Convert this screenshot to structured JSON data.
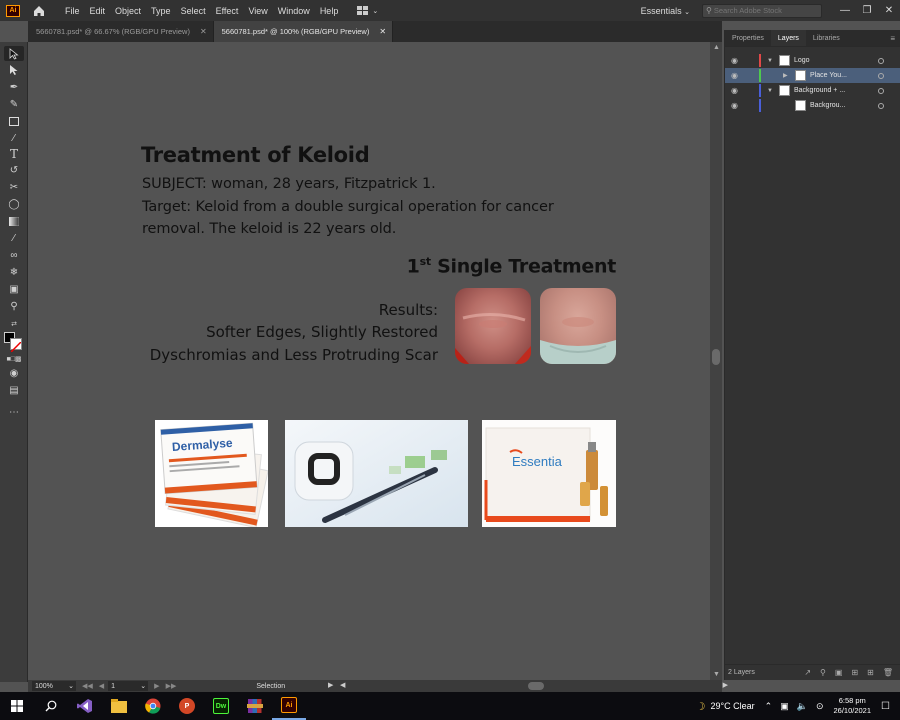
{
  "app": {
    "logo": "Ai",
    "menu": [
      "File",
      "Edit",
      "Object",
      "Type",
      "Select",
      "Effect",
      "View",
      "Window",
      "Help"
    ],
    "workspace": "Essentials",
    "search_placeholder": "Search Adobe Stock"
  },
  "tabs": [
    {
      "label": "5660781.psd* @ 66.67% (RGB/GPU Preview)",
      "active": false
    },
    {
      "label": "5660781.psd* @ 100% (RGB/GPU Preview)",
      "active": true
    }
  ],
  "artboard": {
    "title": "Treatment of Keloid",
    "subject": "SUBJECT: woman, 28 years, Fitzpatrick 1.",
    "target_line1": "Target: Keloid from a double surgical operation for cancer",
    "target_line2": "removal. The keloid is 22 years old.",
    "treatment_num": "1",
    "treatment_sup": "st",
    "treatment_label": "Single Treatment",
    "results_label": "Results:",
    "results_line1": "Softer Edges, Slightly Restored",
    "results_line2": "Dyschromias and Less Protruding Scar",
    "product1_name": "Dermalyse",
    "product3_name": "Essentia"
  },
  "panel": {
    "tabs": [
      "Properties",
      "Layers",
      "Libraries"
    ],
    "active_tab": "Layers",
    "layers": [
      {
        "name": "Logo",
        "color": "#e04848",
        "level": 0,
        "expanded": true
      },
      {
        "name": "Place You...",
        "color": "#4ec84e",
        "level": 1,
        "expanded": false
      },
      {
        "name": "Background + ...",
        "color": "#4a5fd8",
        "level": 0,
        "expanded": true
      },
      {
        "name": "Backgrou...",
        "color": "#4a5fd8",
        "level": 1,
        "expanded": false
      }
    ],
    "footer_count": "2 Layers"
  },
  "status": {
    "zoom": "100%",
    "page": "1",
    "tool": "Selection"
  },
  "taskbar": {
    "weather": "29°C  Clear",
    "time": "6:58 pm",
    "date": "26/10/2021",
    "apps": [
      "Visual Studio",
      "File Explorer",
      "Chrome",
      "PowerPoint",
      "Dw",
      "WinRAR",
      "Ai"
    ]
  }
}
